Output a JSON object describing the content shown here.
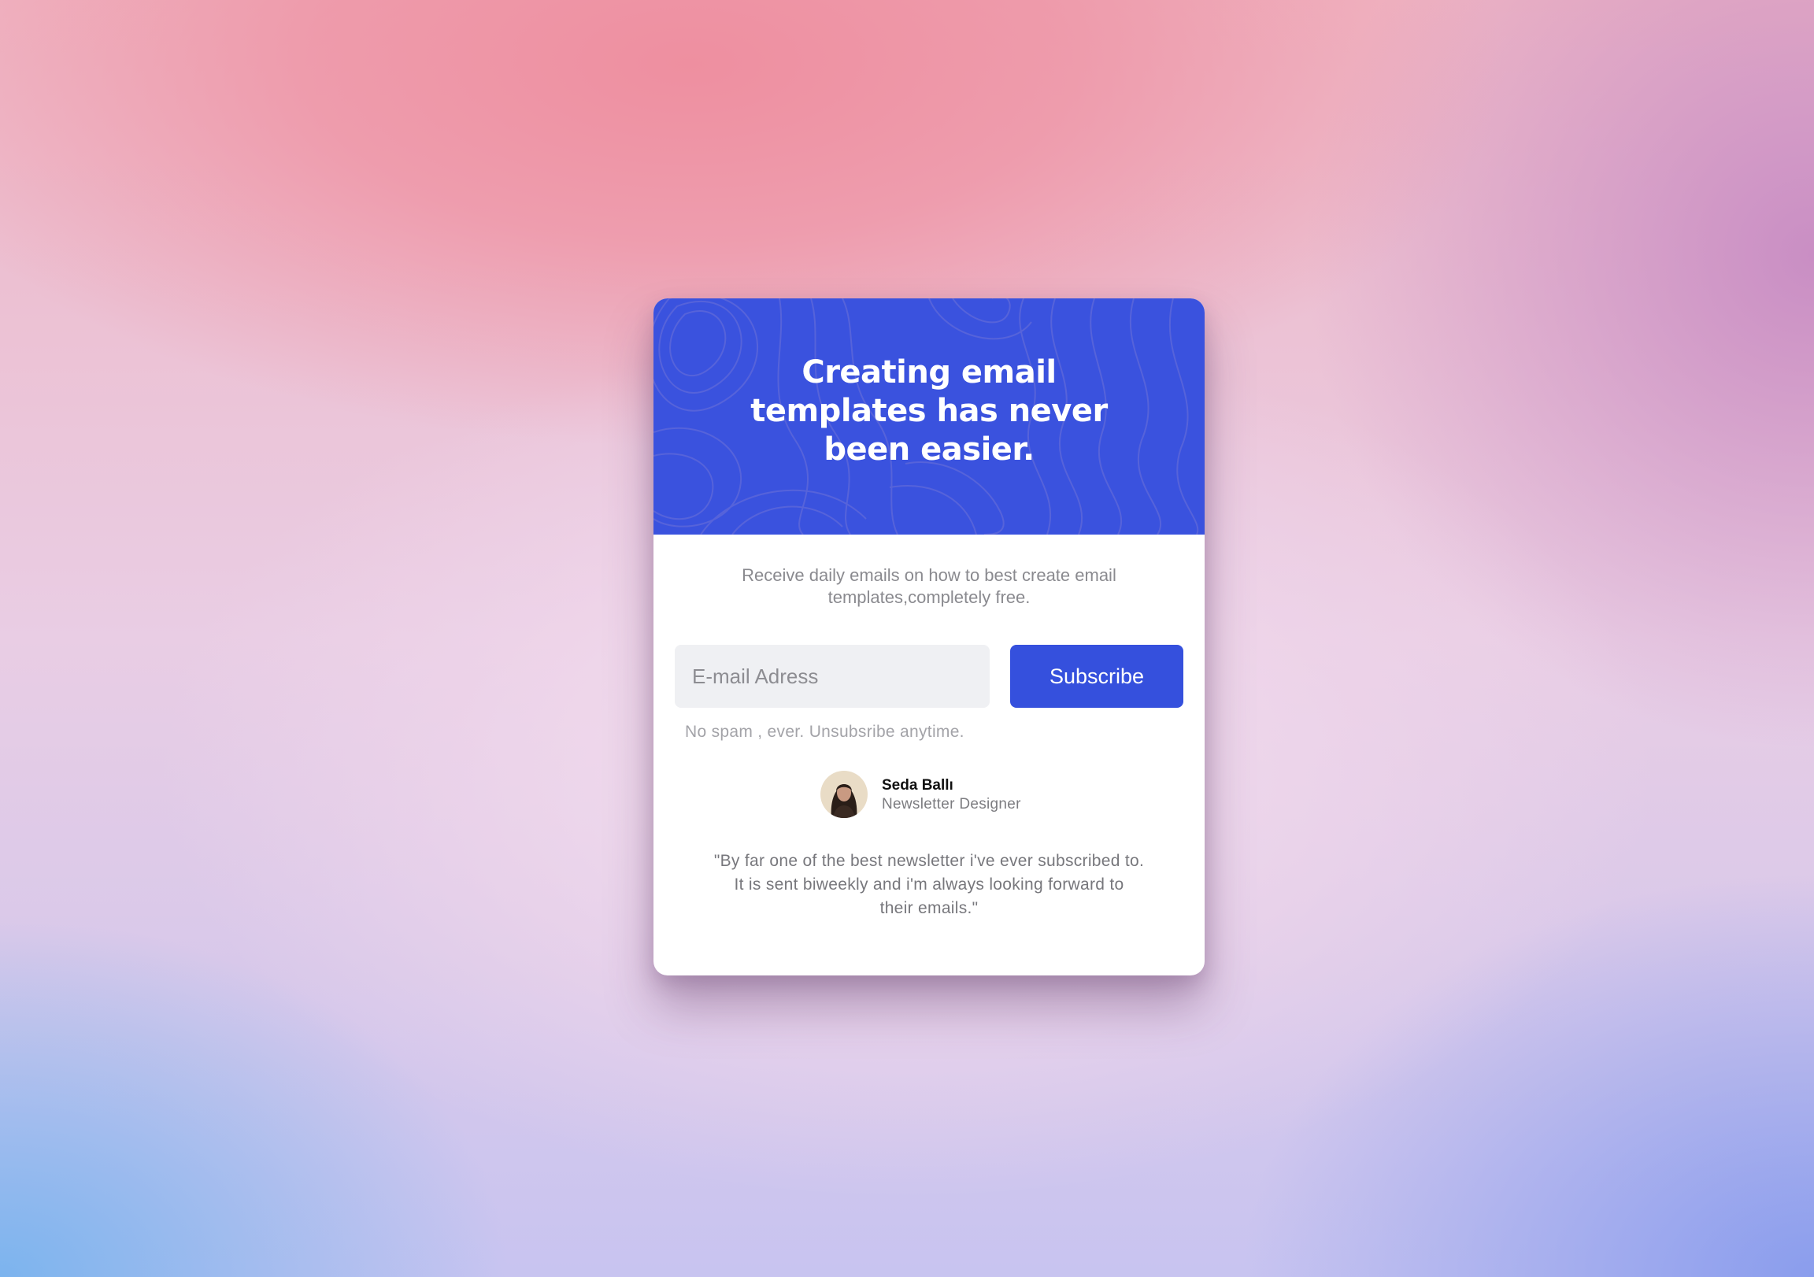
{
  "colors": {
    "accent": "#3550dd",
    "hero_background": "#3a52de",
    "input_background": "#eff0f3"
  },
  "hero": {
    "headline_lines": [
      "Creating email",
      "templates has never",
      "been easier."
    ]
  },
  "subtext": "Receive daily emails on how to best create email templates,completely free.",
  "form": {
    "email_placeholder": "E-mail Adress",
    "email_value": "",
    "subscribe_label": "Subscribe"
  },
  "no_spam_note": "No spam , ever. Unsubsribe anytime.",
  "testimonial": {
    "author_name": "Seda Ballı",
    "author_role": "Newsletter Designer",
    "avatar_icon": "person-avatar",
    "quote_lines": [
      "\"By far one of the best newsletter i've ever subscribed to.",
      "It is sent biweekly and i'm always looking forward to",
      "their emails.\""
    ]
  }
}
